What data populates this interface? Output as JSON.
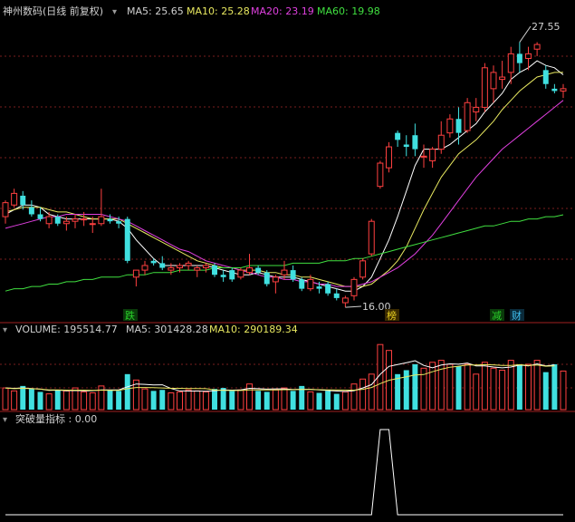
{
  "header": {
    "stock_title": "神州数码(日线 前复权)",
    "ma5": "MA5: 25.65",
    "ma10": "MA10: 25.28",
    "ma20": "MA20: 23.19",
    "ma60": "MA60: 19.98"
  },
  "volume_header": {
    "volume": "VOLUME: 195514.77",
    "ma5": "MA5: 301428.28",
    "ma10": "MA10: 290189.34"
  },
  "indicator_header": {
    "label": "突破量指标 : 0.00"
  },
  "annotations": {
    "high_label": "27.55",
    "low_label": "16.00",
    "tags": [
      "跌",
      "榜",
      "减",
      "财"
    ]
  },
  "colors": {
    "up": "#ff4040",
    "down": "#40e0e0",
    "ma5": "#ffffff",
    "ma10": "#e8e860",
    "ma20": "#e040e0",
    "ma60": "#40e040",
    "grid": "#7a1e1e",
    "tag_green": "#2ad12a",
    "tag_yellow": "#e8d020",
    "tag_cyan": "#40c0f0"
  },
  "chart_data": [
    {
      "type": "candlestick",
      "title": "神州数码(日线 前复权)",
      "ylim": [
        15.5,
        28.2
      ],
      "candles": [
        [
          19.9,
          20.6,
          19.6,
          20.5
        ],
        [
          20.4,
          21.1,
          20.3,
          20.9
        ],
        [
          20.8,
          21.0,
          20.2,
          20.4
        ],
        [
          20.3,
          20.6,
          19.9,
          20.0
        ],
        [
          20.0,
          20.3,
          19.7,
          19.8
        ],
        [
          19.6,
          20.1,
          19.4,
          19.9
        ],
        [
          19.9,
          20.0,
          19.5,
          19.6
        ],
        [
          19.6,
          19.9,
          19.3,
          19.7
        ],
        [
          19.7,
          20.0,
          19.4,
          19.8
        ],
        [
          19.8,
          20.1,
          19.5,
          19.8
        ],
        [
          19.6,
          19.9,
          19.2,
          19.6
        ],
        [
          19.6,
          21.1,
          19.5,
          19.9
        ],
        [
          19.8,
          20.0,
          19.6,
          19.7
        ],
        [
          19.7,
          19.9,
          19.4,
          19.6
        ],
        [
          19.8,
          19.9,
          17.9,
          18.0
        ],
        [
          17.3,
          17.6,
          16.9,
          17.6
        ],
        [
          17.6,
          18.0,
          17.4,
          17.8
        ],
        [
          18.0,
          18.1,
          17.8,
          17.9
        ],
        [
          17.9,
          18.2,
          17.6,
          17.7
        ],
        [
          17.6,
          17.9,
          17.4,
          17.7
        ],
        [
          17.7,
          17.9,
          17.5,
          17.8
        ],
        [
          17.8,
          18.0,
          17.6,
          17.9
        ],
        [
          17.6,
          17.8,
          17.3,
          17.7
        ],
        [
          17.7,
          17.9,
          17.5,
          17.8
        ],
        [
          17.8,
          17.9,
          17.3,
          17.4
        ],
        [
          17.4,
          17.6,
          17.1,
          17.3
        ],
        [
          17.6,
          17.7,
          17.1,
          17.2
        ],
        [
          17.3,
          17.7,
          17.2,
          17.6
        ],
        [
          17.5,
          18.3,
          17.4,
          17.7
        ],
        [
          17.7,
          17.8,
          17.4,
          17.5
        ],
        [
          17.5,
          17.6,
          16.9,
          17.0
        ],
        [
          17.1,
          17.4,
          16.6,
          17.3
        ],
        [
          17.4,
          18.0,
          17.2,
          17.6
        ],
        [
          17.6,
          17.8,
          17.1,
          17.2
        ],
        [
          17.2,
          17.3,
          16.7,
          16.8
        ],
        [
          16.8,
          17.4,
          16.7,
          17.2
        ],
        [
          16.9,
          17.1,
          16.6,
          16.8
        ],
        [
          17.0,
          17.1,
          16.5,
          16.6
        ],
        [
          16.6,
          16.8,
          16.3,
          16.4
        ],
        [
          16.2,
          16.5,
          16.0,
          16.4
        ],
        [
          16.5,
          17.3,
          16.3,
          17.2
        ],
        [
          17.3,
          18.1,
          17.2,
          18.0
        ],
        [
          18.3,
          19.8,
          18.2,
          19.7
        ],
        [
          21.2,
          22.3,
          21.1,
          22.2
        ],
        [
          22.0,
          23.1,
          21.8,
          22.9
        ],
        [
          23.5,
          23.6,
          22.9,
          23.2
        ],
        [
          23.0,
          23.4,
          22.5,
          22.9
        ],
        [
          23.4,
          23.9,
          22.5,
          22.8
        ],
        [
          22.5,
          23.0,
          22.0,
          22.5
        ],
        [
          22.3,
          22.9,
          22.0,
          22.8
        ],
        [
          22.8,
          24.0,
          22.6,
          23.4
        ],
        [
          23.5,
          24.3,
          23.3,
          24.1
        ],
        [
          24.1,
          24.6,
          23.0,
          23.5
        ],
        [
          23.6,
          25.0,
          23.5,
          24.8
        ],
        [
          24.4,
          25.0,
          24.0,
          24.6
        ],
        [
          24.6,
          26.5,
          24.4,
          26.3
        ],
        [
          25.4,
          26.4,
          24.8,
          26.1
        ],
        [
          25.8,
          26.6,
          25.4,
          25.9
        ],
        [
          26.1,
          27.2,
          25.6,
          26.9
        ],
        [
          26.9,
          27.4,
          26.1,
          26.5
        ],
        [
          26.7,
          27.2,
          26.2,
          26.9
        ],
        [
          27.1,
          27.4,
          26.8,
          27.3
        ],
        [
          26.2,
          26.4,
          25.4,
          25.6
        ],
        [
          25.4,
          25.6,
          25.2,
          25.3
        ],
        [
          25.3,
          25.6,
          25.0,
          25.4
        ]
      ],
      "series": [
        {
          "name": "MA5",
          "values": [
            20.0,
            20.2,
            20.4,
            20.4,
            20.3,
            20.0,
            19.9,
            19.8,
            19.8,
            19.8,
            19.8,
            19.8,
            19.8,
            19.7,
            19.4,
            18.9,
            18.5,
            18.1,
            17.8,
            17.8,
            17.8,
            17.8,
            17.8,
            17.8,
            17.7,
            17.6,
            17.5,
            17.4,
            17.4,
            17.5,
            17.4,
            17.3,
            17.3,
            17.3,
            17.2,
            17.1,
            17.0,
            16.9,
            16.8,
            16.7,
            16.7,
            16.9,
            17.3,
            18.1,
            18.9,
            19.9,
            21.0,
            22.1,
            22.8,
            22.8,
            22.8,
            23.0,
            23.3,
            23.6,
            23.9,
            24.4,
            24.8,
            25.2,
            25.8,
            26.1,
            26.3,
            26.6,
            26.4,
            26.3,
            26.0
          ]
        },
        {
          "name": "MA10",
          "values": [
            20.1,
            20.2,
            20.3,
            20.3,
            20.3,
            20.2,
            20.1,
            20.1,
            20.0,
            19.9,
            19.8,
            19.8,
            19.8,
            19.8,
            19.6,
            19.4,
            19.2,
            19.0,
            18.8,
            18.6,
            18.4,
            18.2,
            18.0,
            17.9,
            17.8,
            17.7,
            17.7,
            17.6,
            17.6,
            17.6,
            17.5,
            17.5,
            17.4,
            17.4,
            17.3,
            17.3,
            17.2,
            17.1,
            17.0,
            16.9,
            16.9,
            16.9,
            17.0,
            17.3,
            17.6,
            18.0,
            18.6,
            19.4,
            20.2,
            20.9,
            21.6,
            22.1,
            22.6,
            22.9,
            23.2,
            23.6,
            24.0,
            24.5,
            24.9,
            25.3,
            25.6,
            25.9,
            26.0,
            26.1,
            26.1
          ]
        },
        {
          "name": "MA20",
          "values": [
            19.4,
            19.5,
            19.6,
            19.7,
            19.8,
            19.9,
            19.9,
            20.0,
            20.0,
            20.0,
            20.0,
            20.0,
            19.9,
            19.8,
            19.7,
            19.5,
            19.3,
            19.1,
            18.9,
            18.7,
            18.5,
            18.4,
            18.2,
            18.0,
            17.9,
            17.8,
            17.7,
            17.6,
            17.5,
            17.4,
            17.3,
            17.3,
            17.2,
            17.2,
            17.1,
            17.1,
            17.0,
            17.0,
            16.9,
            16.9,
            16.9,
            17.0,
            17.1,
            17.3,
            17.5,
            17.7,
            18.0,
            18.3,
            18.7,
            19.1,
            19.6,
            20.1,
            20.6,
            21.1,
            21.6,
            22.0,
            22.4,
            22.8,
            23.1,
            23.4,
            23.7,
            24.0,
            24.3,
            24.6,
            24.9
          ]
        },
        {
          "name": "MA60",
          "values": [
            16.7,
            16.8,
            16.8,
            16.9,
            16.9,
            17.0,
            17.0,
            17.1,
            17.1,
            17.2,
            17.2,
            17.3,
            17.3,
            17.3,
            17.4,
            17.4,
            17.4,
            17.5,
            17.5,
            17.5,
            17.6,
            17.6,
            17.6,
            17.6,
            17.7,
            17.7,
            17.7,
            17.7,
            17.8,
            17.8,
            17.8,
            17.8,
            17.8,
            17.9,
            17.9,
            17.9,
            17.9,
            18.0,
            18.0,
            18.0,
            18.1,
            18.1,
            18.2,
            18.3,
            18.4,
            18.5,
            18.6,
            18.7,
            18.8,
            18.9,
            19.0,
            19.1,
            19.2,
            19.3,
            19.4,
            19.5,
            19.5,
            19.6,
            19.7,
            19.7,
            19.8,
            19.8,
            19.9,
            19.9,
            19.98
          ]
        }
      ]
    },
    {
      "type": "bar",
      "title": "VOLUME",
      "ylim": [
        0,
        340000
      ],
      "values": [
        110000,
        95000,
        120000,
        105000,
        90000,
        80000,
        100000,
        95000,
        110000,
        90000,
        85000,
        120000,
        100000,
        95000,
        180000,
        150000,
        105000,
        95000,
        100000,
        85000,
        90000,
        100000,
        95000,
        90000,
        105000,
        110000,
        95000,
        100000,
        130000,
        95000,
        90000,
        100000,
        110000,
        95000,
        120000,
        90000,
        85000,
        95000,
        80000,
        90000,
        130000,
        155000,
        180000,
        330000,
        300000,
        180000,
        200000,
        230000,
        210000,
        240000,
        250000,
        230000,
        220000,
        230000,
        180000,
        240000,
        210000,
        200000,
        250000,
        230000,
        230000,
        250000,
        190000,
        230000,
        195514.77
      ],
      "series": [
        {
          "name": "MA5",
          "values": [
            110000,
            108000,
            110000,
            107000,
            104000,
            98000,
            99000,
            96000,
            97000,
            95000,
            96000,
            100000,
            100000,
            100000,
            116000,
            130000,
            128000,
            125000,
            126000,
            107000,
            95000,
            94000,
            94000,
            93000,
            96000,
            100000,
            99000,
            100000,
            108000,
            106000,
            104000,
            105000,
            105000,
            102000,
            103000,
            103000,
            100000,
            97000,
            94000,
            92000,
            96000,
            110000,
            127000,
            179000,
            219000,
            229000,
            238000,
            248000,
            224000,
            212000,
            226000,
            232000,
            230000,
            236000,
            222000,
            222000,
            216000,
            212000,
            216000,
            226000,
            222000,
            232000,
            222000,
            226000,
            301428.28
          ]
        },
        {
          "name": "MA10",
          "values": [
            110000,
            106000,
            108000,
            106000,
            104000,
            100000,
            100000,
            99000,
            99000,
            99000,
            98000,
            99000,
            98000,
            98000,
            106000,
            112000,
            112000,
            111000,
            110000,
            108000,
            108000,
            107000,
            107000,
            106000,
            100000,
            98000,
            97000,
            97000,
            100000,
            100000,
            100000,
            100000,
            101000,
            101000,
            102000,
            102000,
            101000,
            100000,
            100000,
            99000,
            99000,
            103000,
            112000,
            132000,
            149000,
            158000,
            167000,
            176000,
            178000,
            192000,
            205000,
            215000,
            220000,
            226000,
            226000,
            228000,
            227000,
            224000,
            224000,
            228000,
            224000,
            226000,
            220000,
            222000,
            290189.34
          ]
        }
      ]
    },
    {
      "type": "line",
      "title": "突破量指标",
      "ylim": [
        0,
        1
      ],
      "values": [
        0,
        0,
        0,
        0,
        0,
        0,
        0,
        0,
        0,
        0,
        0,
        0,
        0,
        0,
        0,
        0,
        0,
        0,
        0,
        0,
        0,
        0,
        0,
        0,
        0,
        0,
        0,
        0,
        0,
        0,
        0,
        0,
        0,
        0,
        0,
        0,
        0,
        0,
        0,
        0,
        0,
        0,
        0,
        1,
        1,
        0,
        0,
        0,
        0,
        0,
        0,
        0,
        0,
        0,
        0,
        0,
        0,
        0,
        0,
        0,
        0,
        0,
        0,
        0,
        0
      ]
    }
  ]
}
